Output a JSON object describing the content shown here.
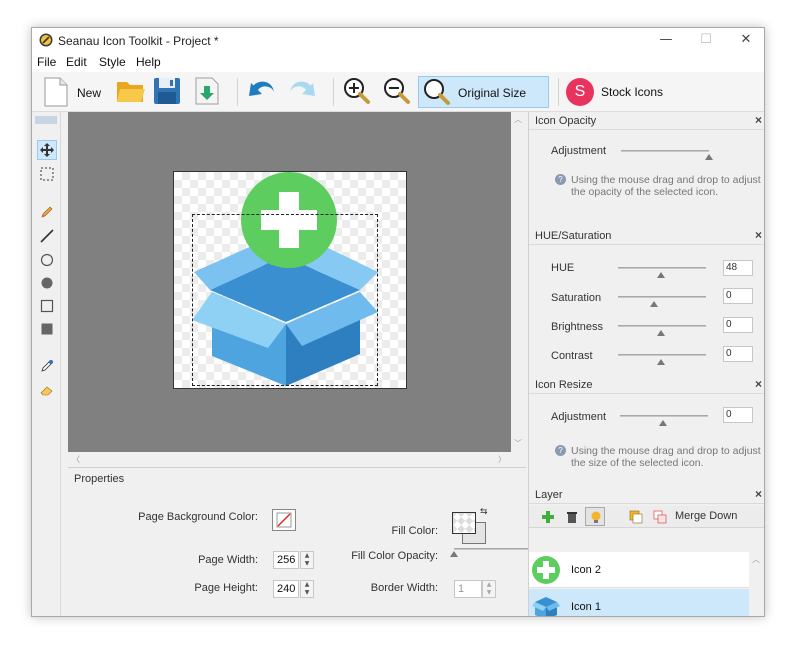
{
  "window": {
    "title": "Seanau Icon Toolkit - Project *",
    "controls": [
      "—",
      "☐",
      "✕"
    ]
  },
  "menu": [
    "File",
    "Edit",
    "Style",
    "Help"
  ],
  "toolbar": {
    "new_label": "New",
    "original_size_label": "Original Size",
    "stock_icons_label": "Stock Icons",
    "stock_badge": "S"
  },
  "properties": {
    "header": "Properties",
    "page_bg_label": "Page Background Color:",
    "page_width_label": "Page Width:",
    "page_width_value": "256",
    "page_height_label": "Page Height:",
    "page_height_value": "240",
    "fill_color_label": "Fill Color:",
    "fill_opacity_label": "Fill Color Opacity:",
    "border_width_label": "Border Width:",
    "border_width_value": "1"
  },
  "icon_opacity": {
    "header": "Icon Opacity",
    "adjust_label": "Adjustment",
    "help": "Using the mouse drag and drop to adjust the opacity of the selected icon."
  },
  "hue_saturation": {
    "header": "HUE/Saturation",
    "rows": [
      {
        "label": "HUE",
        "value": "48"
      },
      {
        "label": "Saturation",
        "value": "0"
      },
      {
        "label": "Brightness",
        "value": "0"
      },
      {
        "label": "Contrast",
        "value": "0"
      }
    ]
  },
  "icon_resize": {
    "header": "Icon Resize",
    "adjust_label": "Adjustment",
    "value": "0",
    "help": "Using the mouse drag and drop to adjust the size of the selected icon."
  },
  "layer": {
    "header": "Layer",
    "merge_down_label": "Merge Down",
    "items": [
      {
        "name": "Icon 2",
        "selected": false
      },
      {
        "name": "Icon 1",
        "selected": true
      }
    ]
  },
  "colors": {
    "canvas_bg": "#808080",
    "accent_selection": "#cde8fb",
    "green_badge": "#5ccd5e",
    "box_blue": "#3b97d3",
    "stock_pink": "#e9335f"
  }
}
